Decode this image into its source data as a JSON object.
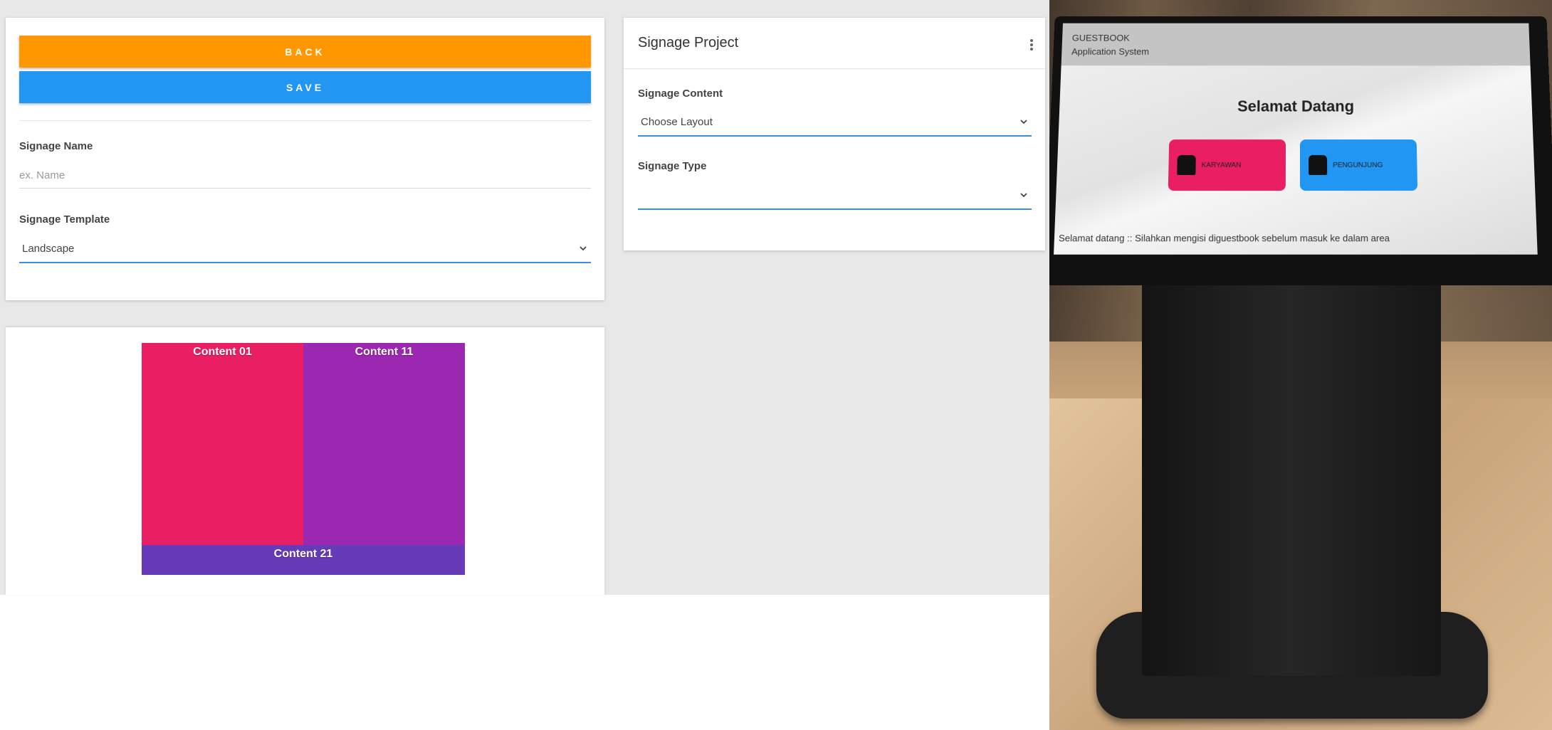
{
  "form": {
    "back_label": "BACK",
    "save_label": "SAVE",
    "name_label": "Signage Name",
    "name_placeholder": "ex. Name",
    "name_value": "",
    "template_label": "Signage Template",
    "template_value": "Landscape"
  },
  "preview": {
    "zones": [
      {
        "label": "Content 01",
        "color": "#e91e63"
      },
      {
        "label": "Content 11",
        "color": "#9c27b0"
      },
      {
        "label": "Content 21",
        "color": "#673ab7"
      }
    ]
  },
  "project": {
    "title": "Signage Project",
    "content_label": "Signage Content",
    "content_value": "Choose Layout",
    "type_label": "Signage Type",
    "type_value": ""
  },
  "kiosk": {
    "header_line1": "GUESTBOOK",
    "header_line2": "Application System",
    "welcome": "Selamat Datang",
    "employee_label": "KARYAWAN",
    "visitor_label": "PENGUNJUNG",
    "ticker": "Selamat datang :: Silahkan mengisi diguestbook sebelum masuk ke dalam area"
  },
  "colors": {
    "back": "#ff9800",
    "save": "#2196f3",
    "accent_underline": "#3b8fdc"
  },
  "icons": {
    "dropdown": "chevron-down-icon",
    "menu": "more-vertical-icon",
    "employee": "user-icon",
    "visitor": "visitor-icon"
  }
}
